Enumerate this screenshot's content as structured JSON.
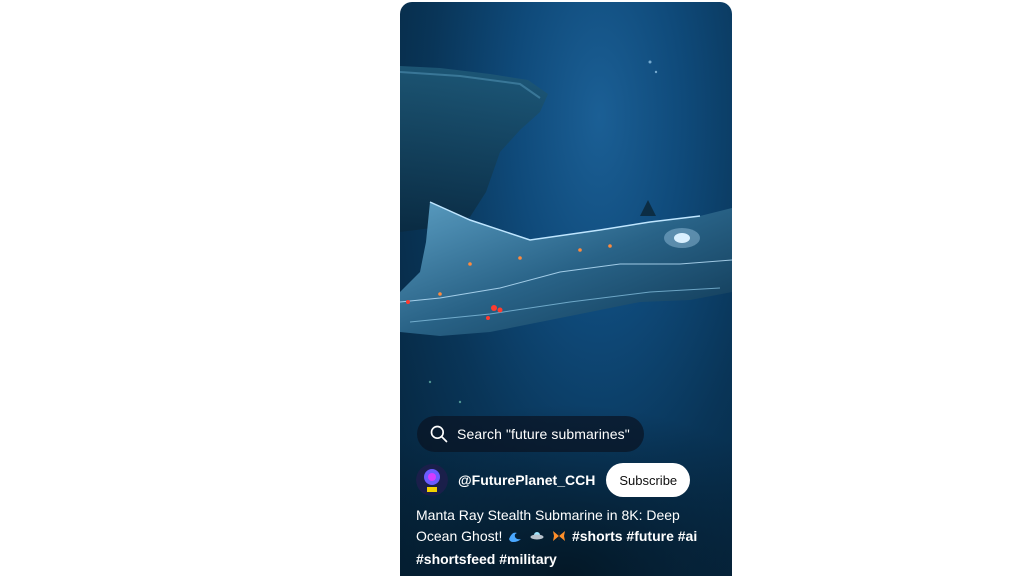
{
  "search": {
    "label": "Search \"future submarines\""
  },
  "channel": {
    "handle": "@FuturePlanet_CCH",
    "subscribe_label": "Subscribe"
  },
  "video": {
    "title_text": "Manta Ray Stealth Submarine in 8K: Deep Ocean Ghost!",
    "hashtags": [
      "#shorts",
      "#future",
      "#ai",
      "#shortsfeed",
      "#military"
    ],
    "emojis": [
      "wave-icon",
      "ufo-icon",
      "butterfly-icon"
    ]
  },
  "colors": {
    "water_top": "#1b5f95",
    "water_deep": "#052238",
    "accent_lights": "#ff3b2f",
    "glow": "#bfe6ff"
  }
}
